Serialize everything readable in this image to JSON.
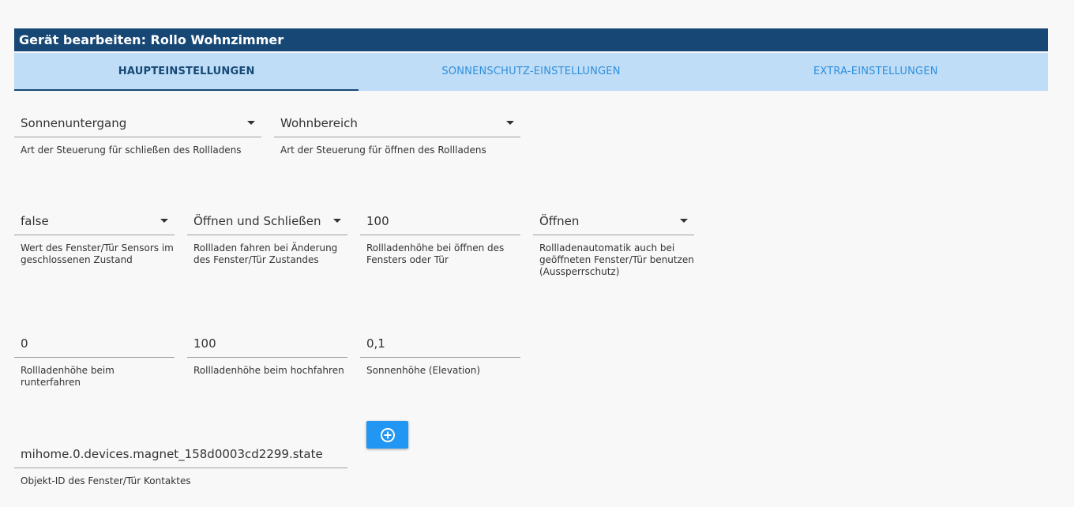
{
  "header": {
    "title": "Gerät bearbeiten: Rollo Wohnzimmer"
  },
  "tabs": [
    {
      "label": "HAUPTEINSTELLUNGEN",
      "active": true
    },
    {
      "label": "SONNENSCHUTZ-EINSTELLUNGEN",
      "active": false
    },
    {
      "label": "EXTRA-EINSTELLUNGEN",
      "active": false
    }
  ],
  "fields": {
    "close_control": {
      "value": "Sonnenuntergang",
      "helper": "Art der Steuerung für schließen des Rollladens"
    },
    "open_control": {
      "value": "Wohnbereich",
      "helper": "Art der Steuerung für öffnen des Rollladens"
    },
    "sensor_closed_value": {
      "value": "false",
      "helper": "Wert des Fenster/Tür Sensors im geschlossenen Zustand"
    },
    "move_on_change": {
      "value": "Öffnen und Schließen",
      "helper": "Rollladen fahren bei Änderung des Fenster/Tür Zustandes"
    },
    "open_height": {
      "value": "100",
      "helper": "Rollladenhöhe bei öffnen des Fensters oder Tür"
    },
    "lockout_protection": {
      "value": "Öffnen",
      "helper": "Rollladenautomatik auch bei geöffneten Fenster/Tür benutzen (Aussperrschutz)"
    },
    "down_height": {
      "value": "0",
      "helper": "Rollladenhöhe beim runterfahren"
    },
    "up_height": {
      "value": "100",
      "helper": "Rollladenhöhe beim hochfahren"
    },
    "sun_elevation": {
      "value": "0,1",
      "helper": "Sonnenhöhe (Elevation)"
    },
    "contact_object_id": {
      "value": "mihome.0.devices.magnet_158d0003cd2299.state",
      "helper": "Objekt-ID des Fenster/Tür Kontaktes"
    }
  },
  "add_button": {
    "icon": "plus-circle-icon"
  },
  "colors": {
    "header_bg": "#174875",
    "tabs_bg": "#bfddf7",
    "accent": "#2196f3"
  }
}
